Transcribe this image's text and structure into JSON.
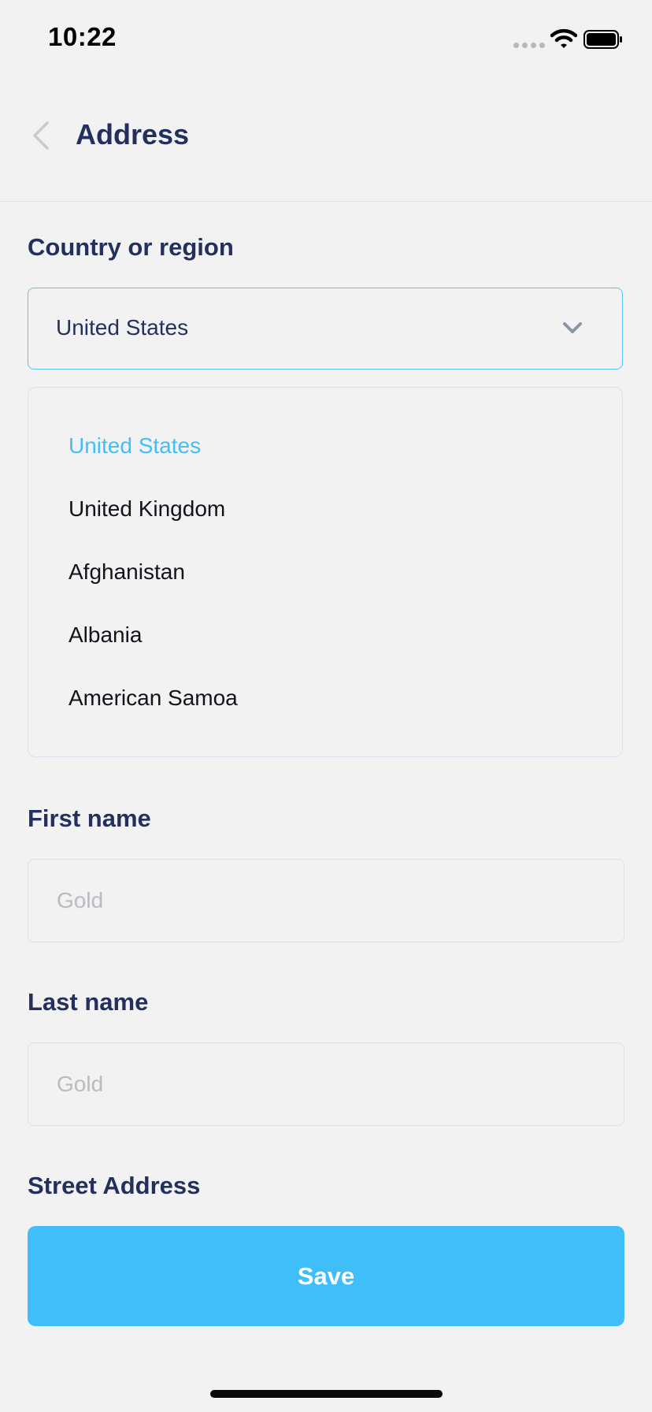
{
  "status_bar": {
    "time": "10:22"
  },
  "header": {
    "title": "Address",
    "back_icon": "chevron-left-icon"
  },
  "country": {
    "label": "Country or region",
    "selected_value": "United States",
    "options": [
      {
        "label": "United States",
        "selected": true
      },
      {
        "label": "United Kingdom",
        "selected": false
      },
      {
        "label": "Afghanistan",
        "selected": false
      },
      {
        "label": "Albania",
        "selected": false
      },
      {
        "label": "American Samoa",
        "selected": false
      }
    ]
  },
  "first_name": {
    "label": "First name",
    "placeholder": "Gold",
    "value": ""
  },
  "last_name": {
    "label": "Last name",
    "placeholder": "Gold",
    "value": ""
  },
  "street_address": {
    "label": "Street Address"
  },
  "save_button": {
    "label": "Save"
  },
  "colors": {
    "background": "#f2f2f3",
    "title_text": "#23305e",
    "accent": "#40bef9",
    "selected_option": "#45bdf7",
    "select_border": "#5dc2f4",
    "input_border": "#dde1ee",
    "placeholder": "#b9bbc2"
  }
}
